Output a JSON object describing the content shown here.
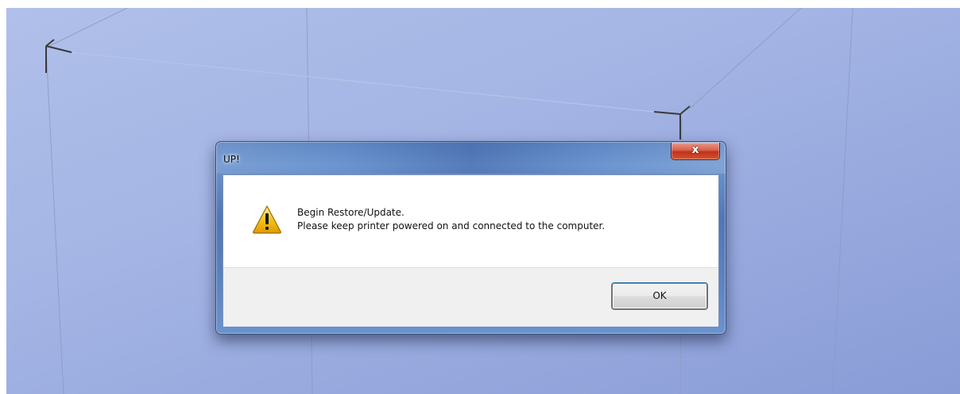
{
  "dialog": {
    "title": "UP!",
    "close_label": "x",
    "icon": "warning-icon",
    "message_line1": "Begin Restore/Update.",
    "message_line2": "Please keep printer powered on and connected to the computer.",
    "ok_label": "OK"
  },
  "colors": {
    "viewport_background": "#a4b4e4",
    "dialog_frame": "#5a82c0",
    "close_button": "#c1301b",
    "warning_icon": "#f5c518"
  }
}
